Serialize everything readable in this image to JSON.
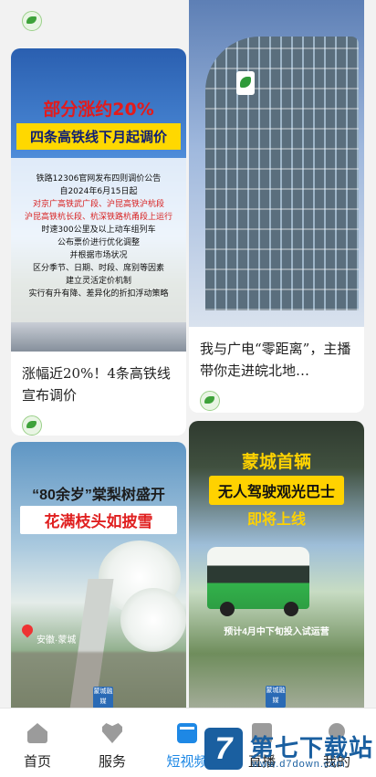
{
  "feed": {
    "cards": [
      {
        "image_text": {
          "headline": "部分涨约20%",
          "subheadline": "四条高铁线下月起调价",
          "lines": [
            "铁路12306官网发布四则调价公告",
            "自2024年6月15日起",
            "对京广高铁武广段、沪昆高铁沪杭段",
            "沪昆高铁杭长段、杭深铁路杭甬段上运行",
            "时速300公里及以上动车组列车",
            "公布票价进行优化调整",
            "并根据市场状况",
            "区分季节、日期、时段、席别等因素",
            "建立灵活定价机制",
            "实行有升有降、差异化的折扣浮动策略"
          ]
        },
        "title": "涨幅近20%！4条高铁线宣布调价"
      },
      {
        "title": "我与广电“零距离”，主播带你走进皖北地…"
      },
      {
        "image_text": {
          "line1": "“80余岁”棠梨树盛开",
          "line2": "花满枝头如披雪",
          "location": "安徽·蒙城",
          "watermark": "蒙城融媒"
        }
      },
      {
        "image_text": {
          "line1": "蒙城首辆",
          "line2": "无人驾驶观光巴士",
          "line3": "即将上线",
          "line4": "预计4月中下旬投入试运营",
          "watermark": "蒙城融媒"
        }
      }
    ]
  },
  "tabbar": {
    "items": [
      {
        "label": "首页",
        "icon": "home-icon"
      },
      {
        "label": "服务",
        "icon": "heart-icon"
      },
      {
        "label": "短视频",
        "icon": "video-icon"
      },
      {
        "label": "直播",
        "icon": "live-icon"
      },
      {
        "label": "我的",
        "icon": "user-icon"
      }
    ],
    "active_index": 2,
    "active_color": "#1e88e5"
  },
  "watermark": {
    "logo_char": "7",
    "name": "第七下载站",
    "url": "www.d7down.com"
  }
}
